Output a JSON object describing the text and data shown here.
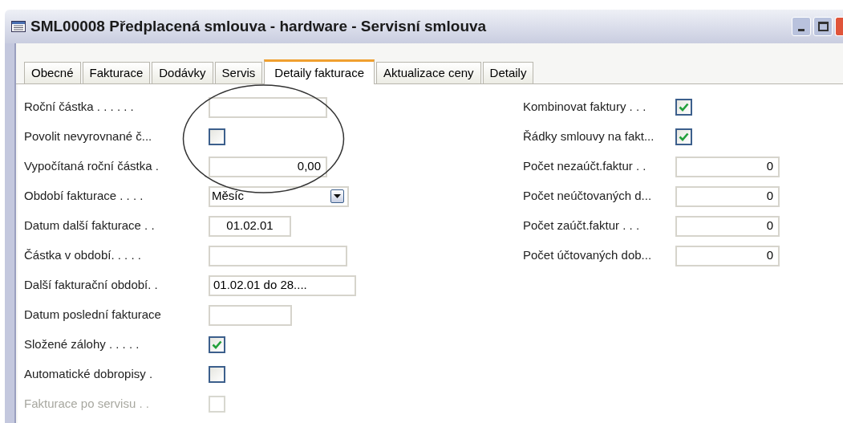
{
  "window": {
    "title": "SML00008 Předplacená smlouva - hardware - Servisní smlouva"
  },
  "tabs": [
    {
      "label": "Obecné",
      "selected": false
    },
    {
      "label": "Fakturace",
      "selected": false
    },
    {
      "label": "Dodávky",
      "selected": false
    },
    {
      "label": "Servis",
      "selected": false
    },
    {
      "label": "Detaily fakturace",
      "selected": true
    },
    {
      "label": "Aktualizace ceny",
      "selected": false
    },
    {
      "label": "Detaily",
      "selected": false
    }
  ],
  "left_fields": [
    {
      "label": "Roční částka . . . . . .",
      "kind": "text",
      "disabled": false
    },
    {
      "label": "Povolit nevyrovnané č...",
      "kind": "checkbox",
      "checked": false,
      "disabled": false
    },
    {
      "label": "Vypočítaná roční částka .",
      "kind": "number",
      "value": "0,00",
      "disabled": false
    },
    {
      "label": "Období fakturace . . . .",
      "kind": "dropdown",
      "value": "Měsíc",
      "disabled": false
    },
    {
      "label": "Datum další fakturace . .",
      "kind": "date",
      "value": "01.02.01",
      "disabled": false
    },
    {
      "label": "Částka v období. . . . .",
      "kind": "text",
      "disabled": false
    },
    {
      "label": "Další fakturační období. .",
      "kind": "text",
      "value": "01.02.01 do 28....",
      "disabled": false
    },
    {
      "label": "Datum poslední fakturace",
      "kind": "text",
      "disabled": false
    },
    {
      "label": "Složené zálohy . . . . .",
      "kind": "checkbox",
      "checked": true,
      "disabled": false
    },
    {
      "label": "Automatické dobropisy .",
      "kind": "checkbox",
      "checked": false,
      "disabled": false
    },
    {
      "label": "Fakturace po servisu . .",
      "kind": "checkbox",
      "checked": false,
      "disabled": true
    }
  ],
  "right_fields": [
    {
      "label": "Kombinovat faktury . . .",
      "kind": "checkbox",
      "checked": true
    },
    {
      "label": "Řádky smlouvy na fakt...",
      "kind": "checkbox",
      "checked": true
    },
    {
      "label": "Počet nezaúčt.faktur . .",
      "kind": "number",
      "value": "0"
    },
    {
      "label": "Počet neúčtovaných d...",
      "kind": "number",
      "value": "0"
    },
    {
      "label": "Počet zaúčt.faktur . . .",
      "kind": "number",
      "value": "0"
    },
    {
      "label": "Počet účtovaných dob...",
      "kind": "number",
      "value": "0"
    }
  ]
}
